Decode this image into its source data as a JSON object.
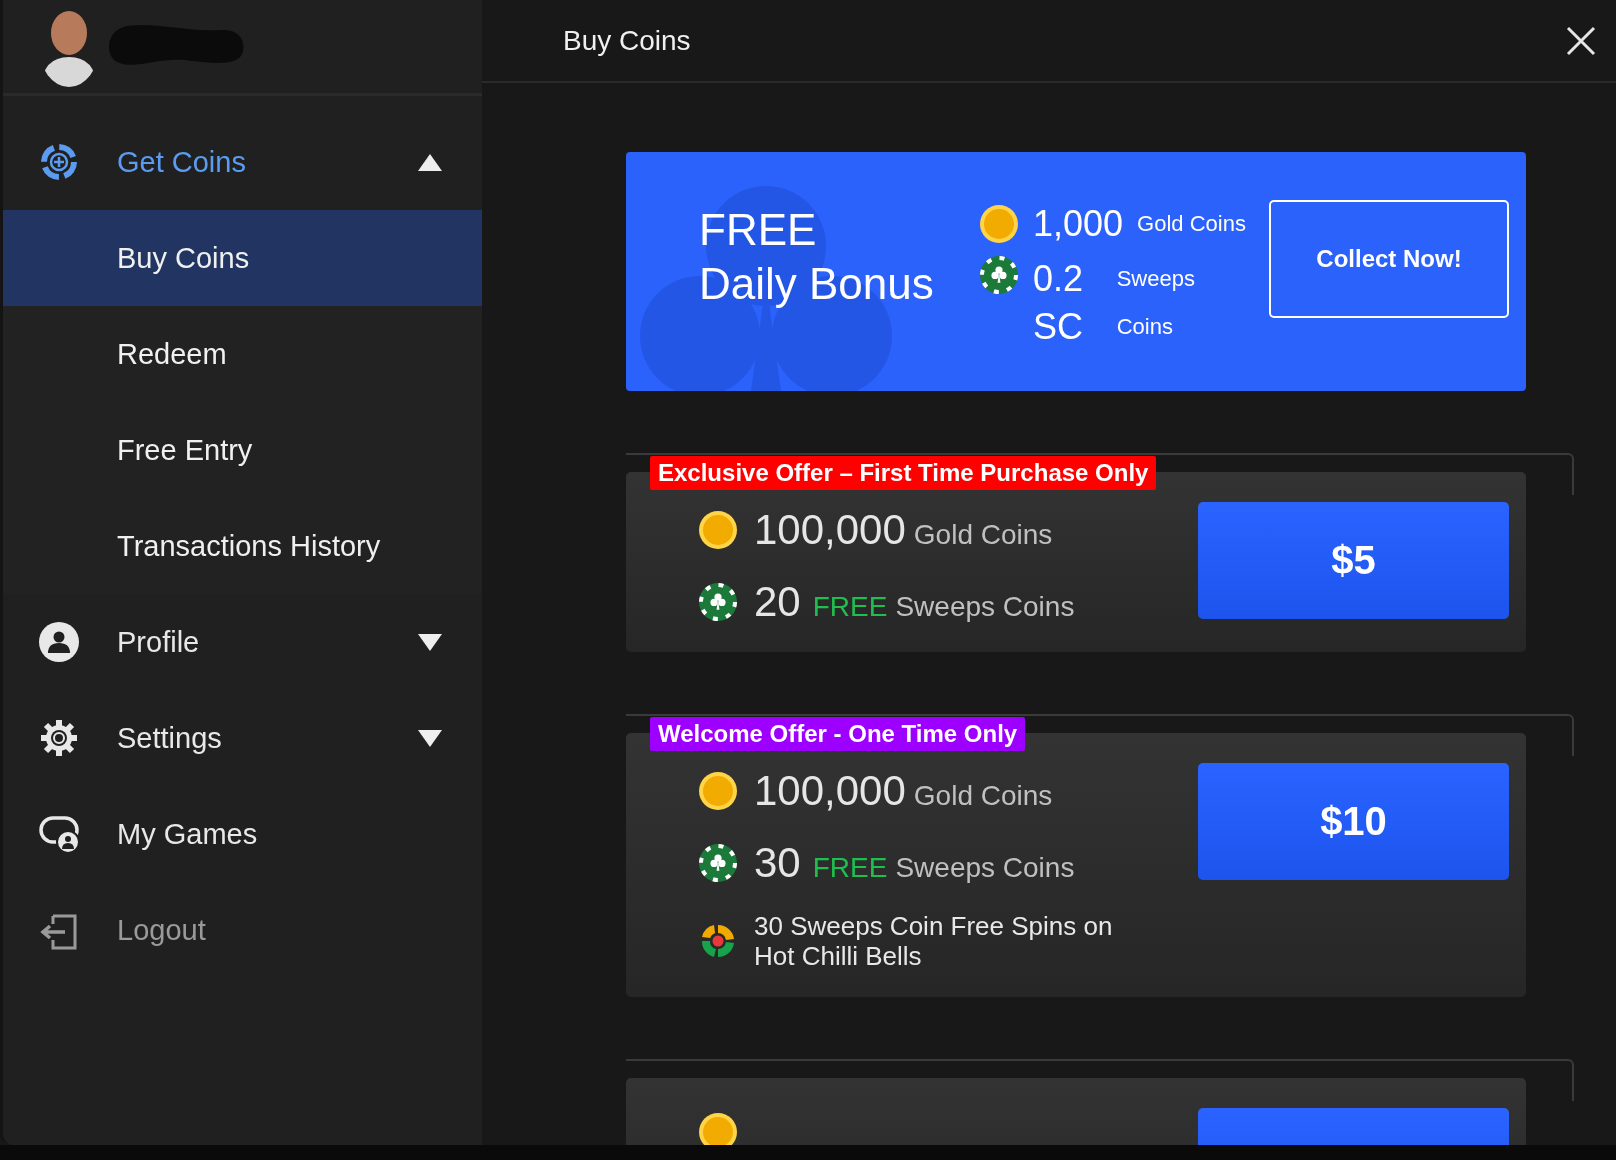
{
  "sidebar": {
    "menu": [
      {
        "label": "Get Coins",
        "kind": "group",
        "expanded": true,
        "children": [
          {
            "label": "Buy Coins",
            "selected": true
          },
          {
            "label": "Redeem",
            "selected": false
          },
          {
            "label": "Free Entry",
            "selected": false
          },
          {
            "label": "Transactions History",
            "selected": false
          }
        ]
      },
      {
        "label": "Profile",
        "kind": "group",
        "expanded": false
      },
      {
        "label": "Settings",
        "kind": "group",
        "expanded": false
      },
      {
        "label": "My Games",
        "kind": "link"
      },
      {
        "label": "Logout",
        "kind": "logout"
      }
    ]
  },
  "main": {
    "title": "Buy Coins",
    "daily_bonus": {
      "title_lines": [
        "FREE",
        "Daily Bonus"
      ],
      "gold_amount": "1,000",
      "gold_label": "Gold Coins",
      "sweeps_amount": "0.2 SC",
      "sweeps_label": "Sweeps Coins",
      "button": "Collect Now!"
    },
    "offers": [
      {
        "tag": "Exclusive Offer – First Time Purchase Only",
        "color": "#ff0000",
        "price": "$5",
        "rewards": [
          {
            "kind": "gold",
            "amount": "100,000",
            "label": "Gold Coins"
          },
          {
            "kind": "sweeps",
            "amount": "20",
            "highlight": "FREE",
            "label": "Sweeps Coins"
          }
        ]
      },
      {
        "tag": "Welcome Offer - One Time Only",
        "color": "#9d00ff",
        "price": "$10",
        "rewards": [
          {
            "kind": "gold",
            "amount": "100,000",
            "label": "Gold Coins"
          },
          {
            "kind": "sweeps",
            "amount": "30",
            "highlight": "FREE",
            "label": "Sweeps Coins"
          },
          {
            "kind": "spins",
            "text": "30 Sweeps Coin Free Spins on Hot Chilli Bells"
          }
        ]
      },
      {
        "rewards": [
          {
            "kind": "gold"
          }
        ]
      }
    ]
  }
}
